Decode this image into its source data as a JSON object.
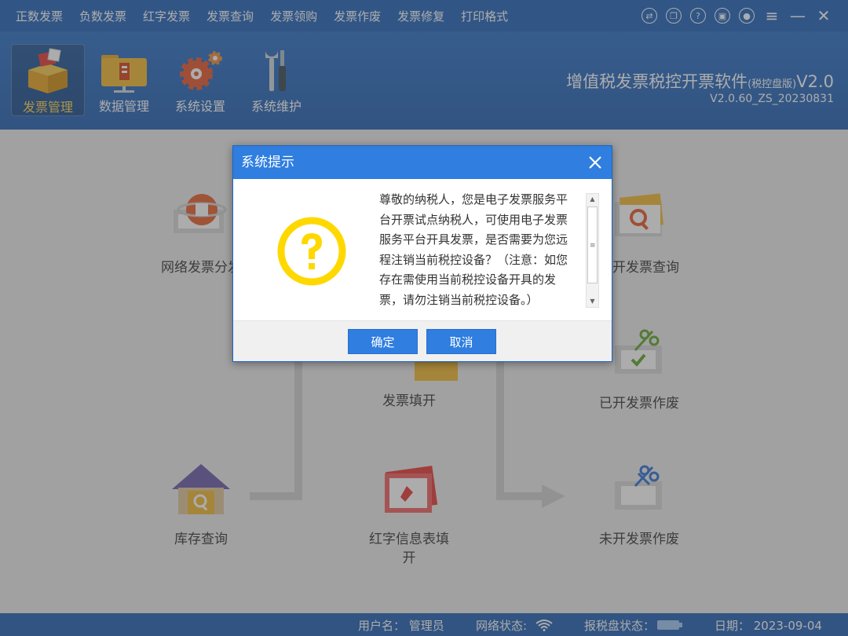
{
  "menu": {
    "items": [
      "正数发票",
      "负数发票",
      "红字发票",
      "发票查询",
      "发票领购",
      "发票作废",
      "发票修复",
      "打印格式"
    ]
  },
  "window_controls": [
    "exchange-icon",
    "copy-icon",
    "help-icon",
    "lock-icon",
    "user-icon",
    "menu-icon",
    "minimize-icon",
    "close-icon"
  ],
  "toolbar": {
    "items": [
      {
        "label": "发票管理",
        "icon": "invoice-box-icon",
        "active": true
      },
      {
        "label": "数据管理",
        "icon": "data-folder-icon",
        "active": false
      },
      {
        "label": "系统设置",
        "icon": "gear-icon",
        "active": false
      },
      {
        "label": "系统维护",
        "icon": "wrench-icon",
        "active": false
      }
    ]
  },
  "app": {
    "title": "增值税发票税控开票软件",
    "edition": "(税控盘版)",
    "short_version": "V2.0",
    "version": "V2.0.60_ZS_20230831"
  },
  "modules": {
    "network_dist": "网络发票分发",
    "issued_query": "已开发票查询",
    "issued_void": "已开发票作废",
    "fill_invoice": "发票填开",
    "stock_query": "库存查询",
    "red_info": "红字信息表填开",
    "unissued_void": "未开发票作废"
  },
  "dialog": {
    "title": "系统提示",
    "message": "尊敬的纳税人，您是电子发票服务平台开票试点纳税人，可使用电子发票服务平台开具发票，是否需要为您远程注销当前税控设备？（注意：如您存在需使用当前税控设备开具的发票，请勿注销当前税控设备。）",
    "ok_label": "确定",
    "cancel_label": "取消"
  },
  "status": {
    "user": "用户名： 管理员",
    "network": "网络状态:",
    "disk": "报税盘状态：",
    "date": "日期： 2023-09-04"
  },
  "colors": {
    "primary": "#1f63ba",
    "dialog_title": "#2f7ee0",
    "question_icon": "#ffd800",
    "active_label": "#ffd34d"
  }
}
